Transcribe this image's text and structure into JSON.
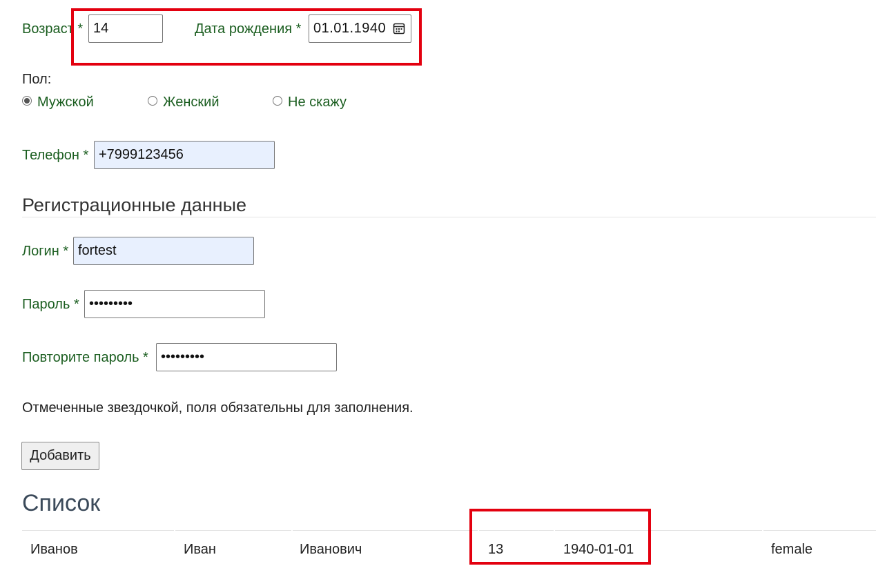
{
  "personal": {
    "age_label": "Возраст *",
    "age_value": "14",
    "birth_label": "Дата рождения *",
    "birth_value": "01.01.1940",
    "calendar_icon": "calendar-icon",
    "gender_label": "Пол:",
    "gender_options": [
      {
        "label": "Мужской",
        "checked": true
      },
      {
        "label": "Женский",
        "checked": false
      },
      {
        "label": "Не скажу",
        "checked": false
      }
    ],
    "phone_label": "Телефон *",
    "phone_value": "+7999123456"
  },
  "registration": {
    "heading": "Регистрационные данные",
    "login_label": "Логин *",
    "login_value": "fortest",
    "password_label": "Пароль *",
    "password_value": "•••••••••",
    "repeat_label": "Повторите пароль *",
    "repeat_value": "•••••••••"
  },
  "note": "Отмеченные звездочкой, поля обязательны для заполнения.",
  "add_button": "Добавить",
  "list": {
    "heading": "Список",
    "rows": [
      [
        "Иванов",
        "Иван",
        "Иванович",
        "13",
        "1940-01-01",
        "female"
      ]
    ]
  },
  "colors": {
    "label_green": "#1b5e20",
    "annotation_red": "#e3000f",
    "autofill_blue": "#e8f0fe"
  }
}
